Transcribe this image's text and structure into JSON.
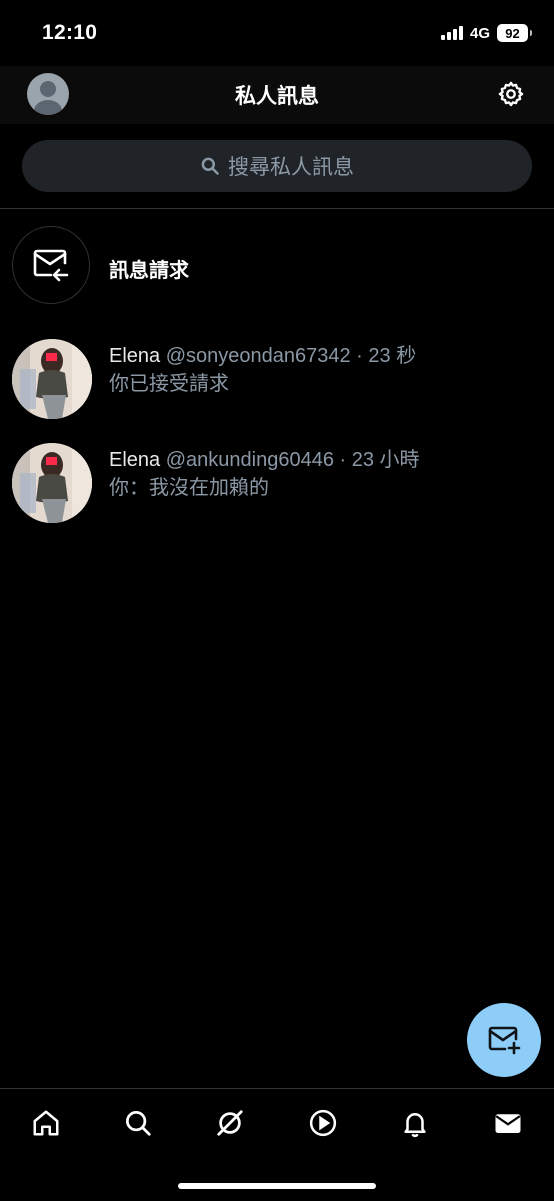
{
  "status_bar": {
    "time": "12:10",
    "network": "4G",
    "battery": "92"
  },
  "header": {
    "title": "私人訊息",
    "avatar_icon": "user-avatar-icon",
    "settings_icon": "gear-icon"
  },
  "search": {
    "placeholder": "搜尋私人訊息",
    "icon": "search-icon"
  },
  "message_requests": {
    "label": "訊息請求",
    "icon": "envelope-arrow-icon"
  },
  "conversations": [
    {
      "name": "Elena",
      "meta": "@sonyeondan67342 · 23 秒",
      "preview": "你已接受請求"
    },
    {
      "name": "Elena",
      "meta": "@ankunding60446 · 23 小時",
      "preview": "你：我沒在加賴的"
    }
  ],
  "fab": {
    "icon": "new-message-icon"
  },
  "bottom_nav": [
    {
      "icon": "home-icon"
    },
    {
      "icon": "search-icon"
    },
    {
      "icon": "grok-icon"
    },
    {
      "icon": "play-icon"
    },
    {
      "icon": "bell-icon"
    },
    {
      "icon": "envelope-icon"
    }
  ],
  "colors": {
    "background": "#000000",
    "text_primary": "#e7e9ea",
    "text_secondary": "#8b98a5",
    "accent": "#8ecdf8",
    "divider": "#2f3336"
  }
}
